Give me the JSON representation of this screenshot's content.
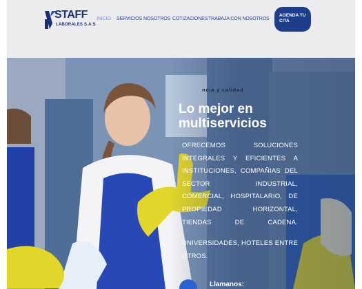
{
  "header": {
    "logo": {
      "brand": "STAFF",
      "subtitle": "LABORALES S.A.S"
    },
    "nav": [
      {
        "label": "Inicio",
        "active": true
      },
      {
        "label": "Servicios"
      },
      {
        "label": "Nosotros"
      },
      {
        "label": "Cotizaciones"
      },
      {
        "label": "Trabaja con nosotros"
      }
    ],
    "cta": {
      "line1": "AGENDA TU",
      "line2": "CITA"
    }
  },
  "hero": {
    "tagline": "ncia y calidad",
    "title_line1": "Lo mejor en",
    "title_line2": "multiservicios",
    "paragraph1": "OFRECEMOS SOLUCIONES INTEGRALES Y EFICIENTES A INSTITUCIONES, COMPAÑIAS DEL SECTOR INDUSTRIAL, COMERCIAL, HOSPITALARIO, DE PROPIEDAD HORIZONTAL, TIENDAS DE CADENA.",
    "paragraph2": "UNIVERSIDADES, HOTELES ENTRE OTROS.",
    "call_label": "Llamanos:"
  },
  "colors": {
    "brand_navy": "#1d2f73",
    "cta_blue": "#1e3d8a",
    "glove_yellow": "#e3d62a",
    "apron_blue": "#2748b5"
  }
}
